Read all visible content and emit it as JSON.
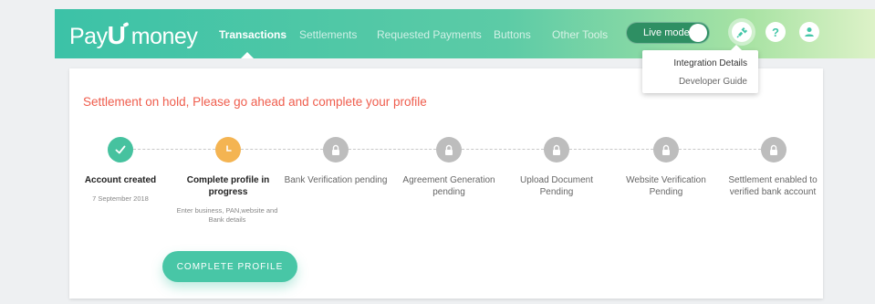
{
  "header": {
    "logo_a": "Pay",
    "logo_u": "U",
    "logo_b": "money",
    "nav": [
      "Transactions",
      "Settlements",
      "Requested Payments",
      "Buttons",
      "Other Tools"
    ],
    "live_mode_label": "Live mode",
    "help_symbol": "?"
  },
  "dropdown": {
    "items": [
      "Integration Details",
      "Developer Guide"
    ]
  },
  "main": {
    "notice": "Settlement on hold, Please go ahead and complete your profile",
    "steps": [
      {
        "status": "done",
        "title": "Account created",
        "subtitle": "7 September 2018",
        "icon": "check-icon"
      },
      {
        "status": "in-progress",
        "title": "Complete profile in progress",
        "subtitle": "Enter business, PAN,website and Bank details",
        "icon": "clock-icon"
      },
      {
        "status": "pending",
        "title": "Bank Verification pending",
        "icon": "lock-icon"
      },
      {
        "status": "pending",
        "title": "Agreement Generation pending",
        "icon": "lock-icon"
      },
      {
        "status": "pending",
        "title": "Upload Document Pending",
        "icon": "lock-icon"
      },
      {
        "status": "pending",
        "title": "Website Verification Pending",
        "icon": "lock-icon"
      },
      {
        "status": "pending",
        "title": "Settlement enabled to verified bank account",
        "icon": "lock-icon"
      }
    ],
    "cta_label": "COMPLETE PROFILE"
  },
  "colors": {
    "brand": "#43c6a8",
    "notice": "#ef5d4d",
    "done": "#46c29f",
    "in_progress": "#f4b452",
    "pending": "#bdbdbd"
  }
}
